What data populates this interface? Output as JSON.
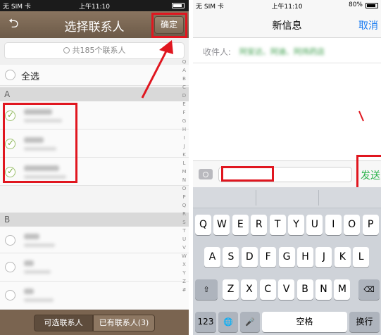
{
  "left_phone": {
    "status": {
      "carrier": "无 SIM 卡",
      "time": "上午11:10"
    },
    "nav": {
      "back_icon": "back-arrow-icon",
      "title": "选择联系人",
      "confirm_label": "确定"
    },
    "search": {
      "placeholder": "共185个联系人",
      "icon": "search-icon"
    },
    "select_all_label": "全选",
    "sections": [
      {
        "letter": "A"
      },
      {
        "letter": "B"
      }
    ],
    "index_letters": [
      "Q",
      "A",
      "B",
      "C",
      "D",
      "E",
      "F",
      "G",
      "H",
      "I",
      "J",
      "K",
      "L",
      "M",
      "N",
      "O",
      "P",
      "Q",
      "R",
      "S",
      "T",
      "U",
      "V",
      "W",
      "X",
      "Y",
      "Z",
      "#"
    ],
    "bottom_tabs": {
      "available": "可选联系人",
      "existing": "已有联系人(3)"
    },
    "colors": {
      "nav_brown": "#7a6450",
      "highlight_red": "#e0161f",
      "check_green": "#7aaa3c"
    }
  },
  "right_phone": {
    "status": {
      "carrier": "无 SIM 卡",
      "time": "上午11:10",
      "battery": "80%"
    },
    "nav": {
      "title": "新信息",
      "cancel_label": "取消"
    },
    "recipient": {
      "label": "收件人:",
      "names": "阿安达、阿迪、阿炜药店"
    },
    "compose": {
      "camera_icon": "camera-icon",
      "send_label": "发送"
    },
    "keyboard": {
      "row1": [
        "Q",
        "W",
        "E",
        "R",
        "T",
        "Y",
        "U",
        "I",
        "O",
        "P"
      ],
      "row2": [
        "A",
        "S",
        "D",
        "F",
        "G",
        "H",
        "J",
        "K",
        "L"
      ],
      "row3": [
        "Z",
        "X",
        "C",
        "V",
        "B",
        "N",
        "M"
      ],
      "shift_icon": "shift-icon",
      "delete_icon": "delete-icon",
      "numbers_label": "123",
      "globe_icon": "globe-icon",
      "mic_icon": "microphone-icon",
      "space_label": "空格",
      "return_label": "换行"
    },
    "colors": {
      "cancel_blue": "#1a7cf2",
      "send_green": "#2bb34b"
    }
  }
}
